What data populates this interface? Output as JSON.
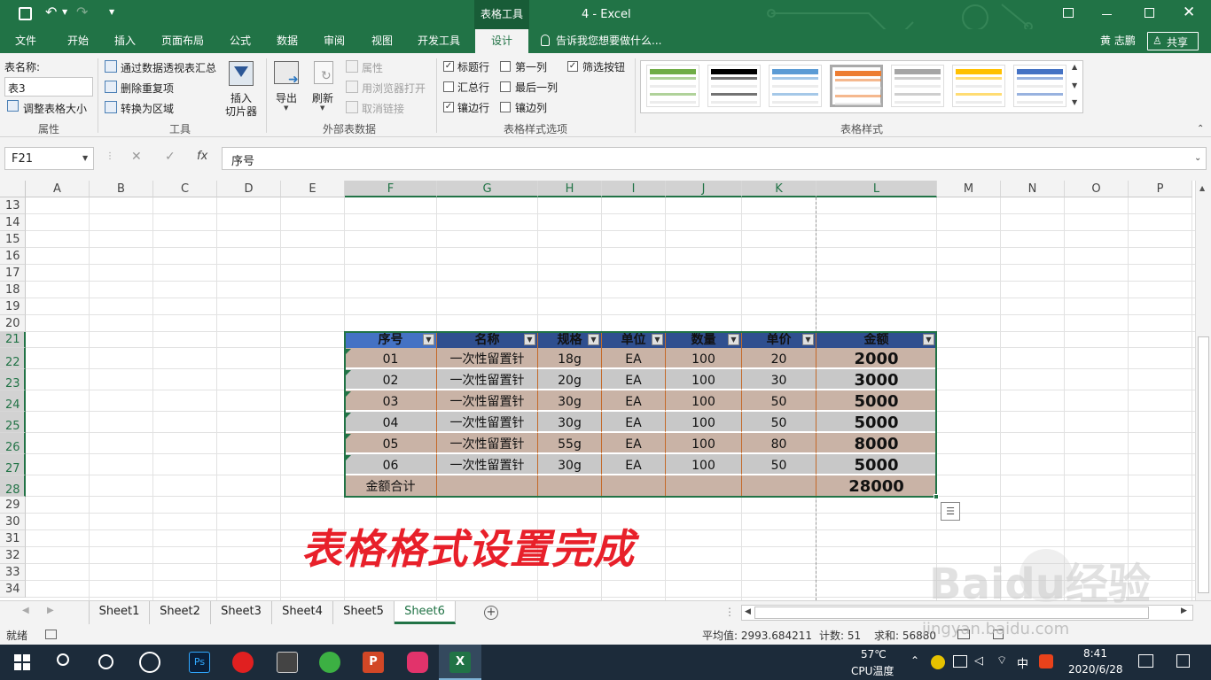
{
  "window": {
    "contextual_tab": "表格工具",
    "title": "4 - Excel"
  },
  "ribbon_tabs": [
    "文件",
    "开始",
    "插入",
    "页面布局",
    "公式",
    "数据",
    "审阅",
    "视图",
    "开发工具",
    "设计"
  ],
  "tell_me": "告诉我您想要做什么...",
  "user": "黄 志鹏",
  "share": "共享",
  "ribbon": {
    "table_name_label": "表名称:",
    "table_name_value": "表3",
    "resize_table": "调整表格大小",
    "group_properties": "属性",
    "pivot_summary": "通过数据透视表汇总",
    "remove_duplicates": "删除重复项",
    "convert_to_range": "转换为区域",
    "insert_slicer_line1": "插入",
    "insert_slicer_line2": "切片器",
    "group_tools": "工具",
    "export": "导出",
    "refresh": "刷新",
    "properties": "属性",
    "open_in_browser": "用浏览器打开",
    "unlink": "取消链接",
    "group_external": "外部表数据",
    "opt_header_row": "标题行",
    "opt_first_col": "第一列",
    "opt_filter_btn": "筛选按钮",
    "opt_total_row": "汇总行",
    "opt_last_col": "最后一列",
    "opt_banded_rows": "镶边行",
    "opt_banded_cols": "镶边列",
    "group_style_options": "表格样式选项",
    "group_table_styles": "表格样式",
    "style_colors": [
      "#70ad47",
      "#000000",
      "#5b9bd5",
      "#ed7d31",
      "#a5a5a5",
      "#ffc000",
      "#4472c4"
    ]
  },
  "formula_bar": {
    "name_box": "F21",
    "fx": "fx",
    "value": "序号"
  },
  "columns": [
    "A",
    "B",
    "C",
    "D",
    "E",
    "F",
    "G",
    "H",
    "I",
    "J",
    "K",
    "L",
    "M",
    "N",
    "O",
    "P"
  ],
  "rows": [
    "13",
    "14",
    "15",
    "16",
    "17",
    "18",
    "19",
    "20",
    "21",
    "22",
    "23",
    "24",
    "25",
    "26",
    "27",
    "28",
    "29",
    "30",
    "31",
    "32",
    "33",
    "34"
  ],
  "table": {
    "headers": [
      "序号",
      "名称",
      "规格",
      "单位",
      "数量",
      "单价",
      "金额"
    ],
    "rows": [
      [
        "01",
        "一次性留置针",
        "18g",
        "EA",
        "100",
        "20",
        "2000"
      ],
      [
        "02",
        "一次性留置针",
        "20g",
        "EA",
        "100",
        "30",
        "3000"
      ],
      [
        "03",
        "一次性留置针",
        "30g",
        "EA",
        "100",
        "50",
        "5000"
      ],
      [
        "04",
        "一次性留置针",
        "30g",
        "EA",
        "100",
        "50",
        "5000"
      ],
      [
        "05",
        "一次性留置针",
        "55g",
        "EA",
        "100",
        "80",
        "8000"
      ],
      [
        "06",
        "一次性留置针",
        "30g",
        "EA",
        "100",
        "50",
        "5000"
      ]
    ],
    "total_label": "金额合计",
    "total_value": "28000",
    "colors": {
      "header": "#2f4f8f",
      "band_a": "#c9b3a6",
      "band_b": "#c8c8c8",
      "border": "#c46a2a"
    }
  },
  "overlay_text": "表格格式设置完成",
  "sheets": [
    "Sheet1",
    "Sheet2",
    "Sheet3",
    "Sheet4",
    "Sheet5",
    "Sheet6"
  ],
  "active_sheet": "Sheet6",
  "status": {
    "ready": "就绪",
    "average": "平均值: 2993.684211",
    "count": "计数: 51",
    "sum": "求和: 56880"
  },
  "watermark": "Baidu经验",
  "watermark_url": "jingyan.baidu.com",
  "taskbar": {
    "temp": "57℃",
    "temp_label": "CPU温度",
    "ime": "中",
    "time": "8:41",
    "date": "2020/6/28"
  }
}
